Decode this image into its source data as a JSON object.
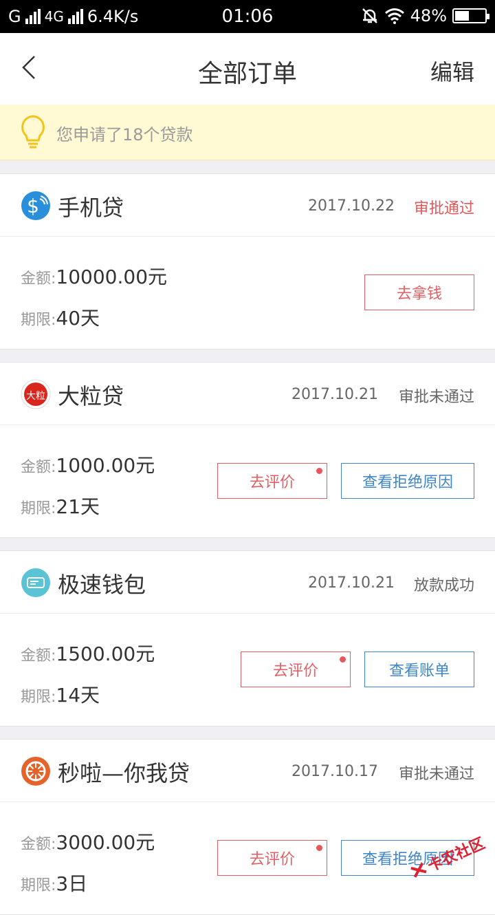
{
  "status_bar": {
    "carrier": "G",
    "network": "4G",
    "speed": "6.4K/s",
    "time": "01:06",
    "battery": "48%",
    "battery_level": 0.48
  },
  "nav": {
    "title": "全部订单",
    "edit_label": "编辑"
  },
  "notice": {
    "text": "您申请了18个贷款"
  },
  "labels": {
    "amount": "金额:",
    "term": "期限:"
  },
  "orders": [
    {
      "name": "手机贷",
      "date": "2017.10.22",
      "status": "审批通过",
      "amount": "10000.00元",
      "term": "40天",
      "buttons": [
        {
          "label": "去拿钱",
          "style": "red",
          "dot": false
        }
      ]
    },
    {
      "name": "大粒贷",
      "date": "2017.10.21",
      "status": "审批未通过",
      "amount": "1000.00元",
      "term": "21天",
      "buttons": [
        {
          "label": "去评价",
          "style": "red",
          "dot": true
        },
        {
          "label": "查看拒绝原因",
          "style": "blue",
          "dot": false
        }
      ]
    },
    {
      "name": "极速钱包",
      "date": "2017.10.21",
      "status": "放款成功",
      "amount": "1500.00元",
      "term": "14天",
      "buttons": [
        {
          "label": "去评价",
          "style": "red",
          "dot": true
        },
        {
          "label": "查看账单",
          "style": "blue",
          "dot": false
        }
      ]
    },
    {
      "name": "秒啦—你我贷",
      "date": "2017.10.17",
      "status": "审批未通过",
      "amount": "3000.00元",
      "term": "3日",
      "buttons": [
        {
          "label": "去评价",
          "style": "red",
          "dot": true
        },
        {
          "label": "查看拒绝原因",
          "style": "blue",
          "dot": false
        }
      ]
    }
  ],
  "watermark": "卡农社区",
  "colors": {
    "accent_red": "#e0585a",
    "accent_blue": "#3f86c8",
    "notice_bg": "#fff9d4"
  }
}
